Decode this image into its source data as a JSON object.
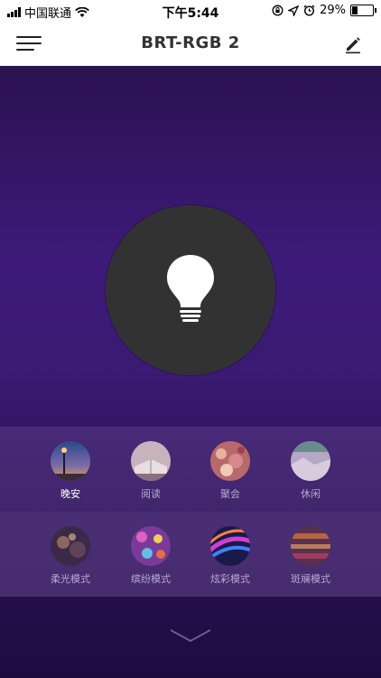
{
  "status_bar": {
    "carrier": "中国联通",
    "time": "下午5:44",
    "battery": "29%",
    "battery_level": 0.29
  },
  "nav": {
    "title": "BRT-RGB 2",
    "menu_icon": "hamburger-icon",
    "edit_icon": "pencil-icon"
  },
  "bulb": {
    "icon": "lightbulb-icon"
  },
  "scenes": {
    "row1": [
      {
        "label": "晚安",
        "active": true
      },
      {
        "label": "阅读",
        "active": false
      },
      {
        "label": "聚会",
        "active": false
      },
      {
        "label": "休闲",
        "active": false
      }
    ],
    "row2": [
      {
        "label": "柔光模式",
        "active": false
      },
      {
        "label": "缤纷模式",
        "active": false
      },
      {
        "label": "炫彩模式",
        "active": false
      },
      {
        "label": "斑斓模式",
        "active": false
      }
    ]
  },
  "expand_icon": "chevron-down-icon"
}
